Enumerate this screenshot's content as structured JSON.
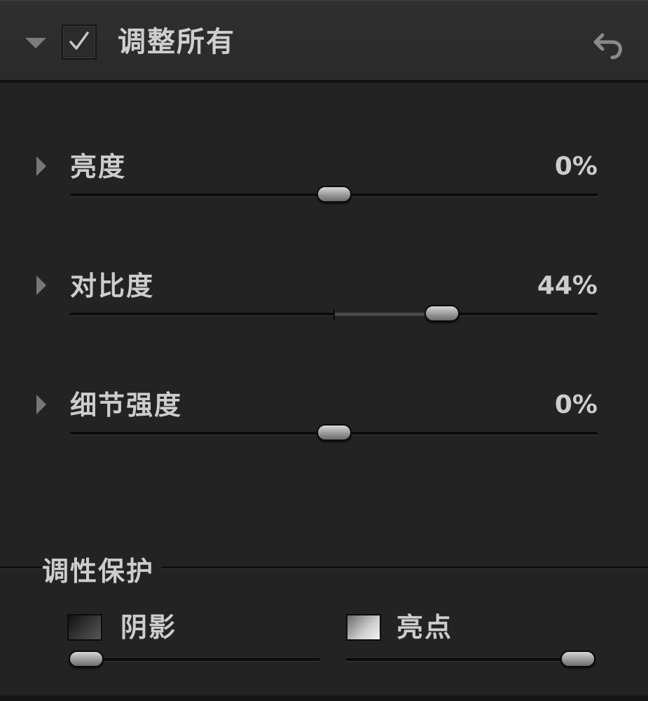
{
  "header": {
    "title": "调整所有",
    "enabled": true,
    "collapse_icon": "triangle-down-icon",
    "reset_icon": "undo-icon"
  },
  "adjustments": [
    {
      "label": "亮度",
      "value_text": "0%",
      "value": 0
    },
    {
      "label": "对比度",
      "value_text": "44%",
      "value": 44
    },
    {
      "label": "细节强度",
      "value_text": "0%",
      "value": 0
    }
  ],
  "tonal_protection": {
    "title": "调性保护",
    "shadows": {
      "label": "阴影",
      "level": 0
    },
    "highlights": {
      "label": "亮点",
      "level": 1
    }
  },
  "colors": {
    "panel_bg": "#232324",
    "header_bg": "#2c2c2d",
    "text": "#cdcdcd"
  }
}
